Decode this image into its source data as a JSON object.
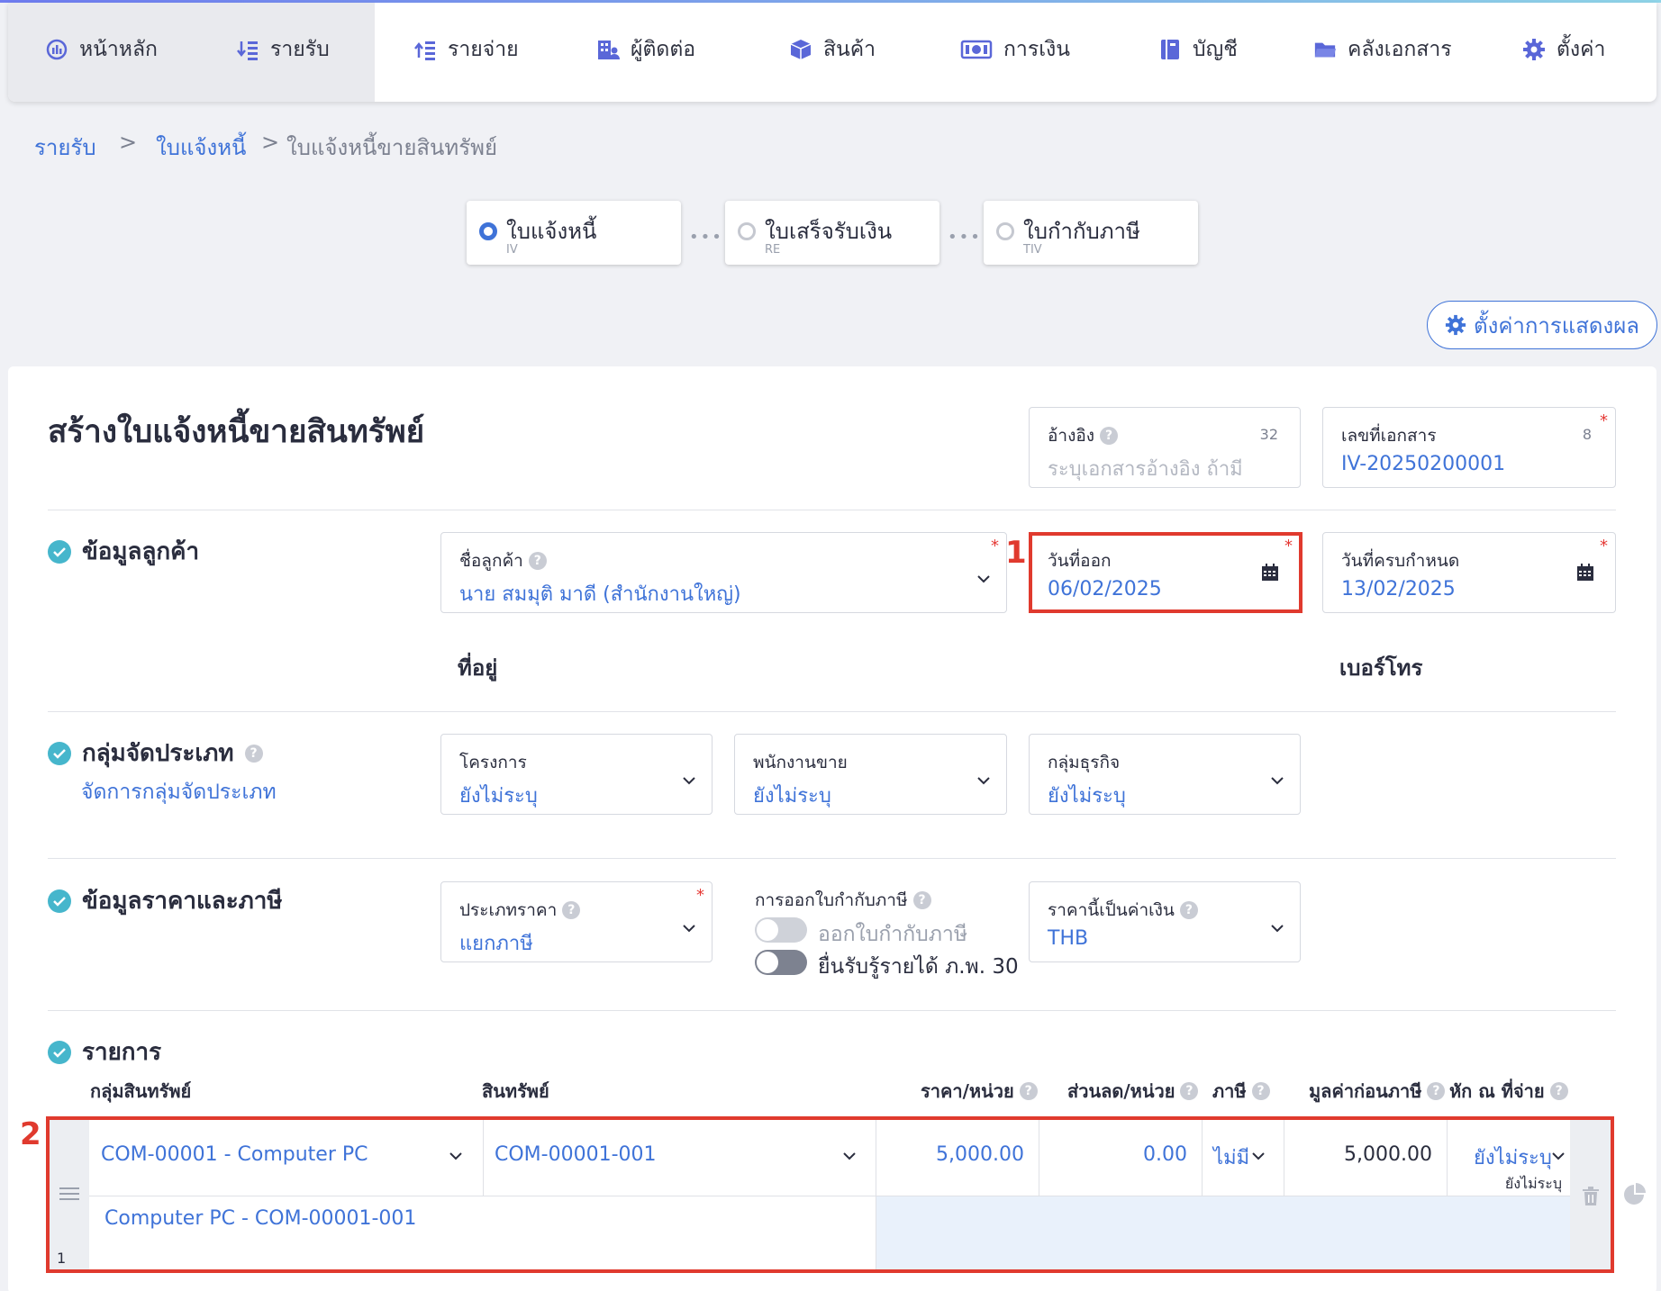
{
  "nav": {
    "items": [
      {
        "label": "หน้าหลัก",
        "icon": "dashboard-icon"
      },
      {
        "label": "รายรับ",
        "icon": "income-icon"
      },
      {
        "label": "รายจ่าย",
        "icon": "expense-icon"
      },
      {
        "label": "ผู้ติดต่อ",
        "icon": "contacts-icon"
      },
      {
        "label": "สินค้า",
        "icon": "box-icon"
      },
      {
        "label": "การเงิน",
        "icon": "money-icon"
      },
      {
        "label": "บัญชี",
        "icon": "ledger-icon"
      },
      {
        "label": "คลังเอกสาร",
        "icon": "folder-icon"
      },
      {
        "label": "ตั้งค่า",
        "icon": "gear-icon"
      }
    ]
  },
  "breadcrumb": {
    "items": [
      "รายรับ",
      "ใบแจ้งหนี้",
      "ใบแจ้งหนี้ขายสินทรัพย์"
    ],
    "sep": ">"
  },
  "steps": [
    {
      "title": "ใบแจ้งหนี้",
      "code": "IV"
    },
    {
      "title": "ใบเสร็จรับเงิน",
      "code": "RE"
    },
    {
      "title": "ใบกำกับภาษี",
      "code": "TIV"
    }
  ],
  "display_settings_label": "ตั้งค่าการแสดงผล",
  "page_title": "สร้างใบแจ้งหนี้ขายสินทรัพย์",
  "reference": {
    "label": "อ้างอิง",
    "placeholder": "ระบุเอกสารอ้างอิง ถ้ามี",
    "count": "32"
  },
  "doc_number": {
    "label": "เลขที่เอกสาร",
    "value": "IV-20250200001",
    "count": "8"
  },
  "customer_section": {
    "title": "ข้อมูลลูกค้า",
    "customer_name_label": "ชื่อลูกค้า",
    "customer_name_value": "นาย สมมุติ มาดี (สำนักงานใหญ่)",
    "issue_date_label": "วันที่ออก",
    "issue_date_value": "06/02/2025",
    "due_date_label": "วันที่ครบกำหนด",
    "due_date_value": "13/02/2025",
    "address_label": "ที่อยู่",
    "phone_label": "เบอร์โทร"
  },
  "category_section": {
    "title": "กลุ่มจัดประเภท",
    "manage_link": "จัดการกลุ่มจัดประเภท",
    "project_label": "โครงการ",
    "project_value": "ยังไม่ระบุ",
    "salesperson_label": "พนักงานขาย",
    "salesperson_value": "ยังไม่ระบุ",
    "business_group_label": "กลุ่มธุรกิจ",
    "business_group_value": "ยังไม่ระบุ"
  },
  "pricing_section": {
    "title": "ข้อมูลราคาและภาษี",
    "price_type_label": "ประเภทราคา",
    "price_type_value": "แยกภาษี",
    "tax_invoice_label": "การออกใบกำกับภาษี",
    "toggle1_label": "ออกใบกำกับภาษี",
    "toggle2_label": "ยื่นรับรู้รายได้ ภ.พ. 30",
    "currency_label": "ราคานี้เป็นค่าเงิน",
    "currency_value": "THB"
  },
  "items_section": {
    "title": "รายการ",
    "headers": {
      "asset_group": "กลุ่มสินทรัพย์",
      "asset": "สินทรัพย์",
      "unit_price": "ราคา/หน่วย",
      "discount": "ส่วนลด/หน่วย",
      "tax": "ภาษี",
      "pre_tax": "มูลค่าก่อนภาษี",
      "withholding": "หัก ณ ที่จ่าย"
    },
    "rows": [
      {
        "asset_group": "COM-00001 - Computer PC",
        "asset": "COM-00001-001",
        "unit_price": "5,000.00",
        "discount": "0.00",
        "tax": "ไม่มี",
        "pre_tax": "5,000.00",
        "withholding": "ยังไม่ระบุ",
        "withholding_sub": "ยังไม่ระบุ",
        "description": "Computer PC - COM-00001-001",
        "index": "1"
      }
    ]
  },
  "annotations": {
    "marker1": "1",
    "marker2": "2"
  },
  "colors": {
    "accent": "#3f73d8",
    "highlight": "#e03a2e",
    "check": "#46b6cc"
  }
}
